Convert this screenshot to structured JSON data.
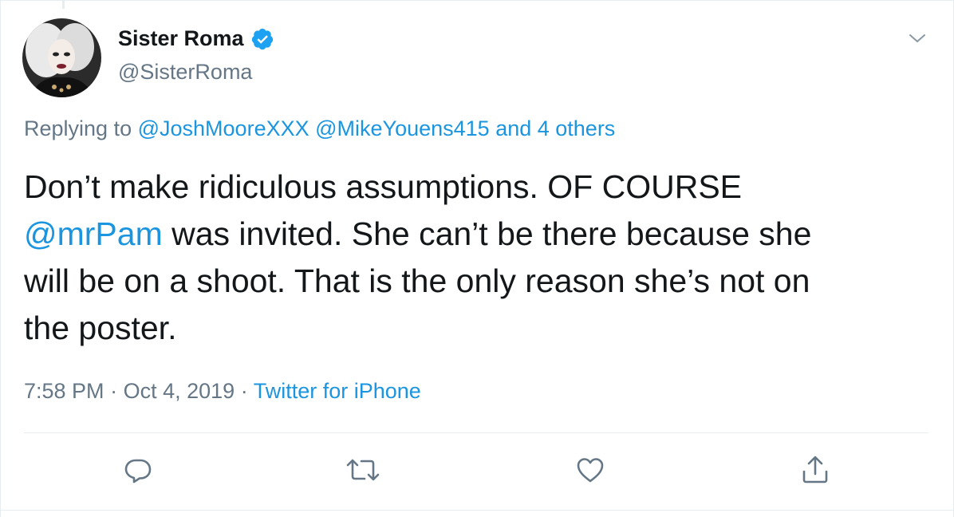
{
  "author": {
    "display_name": "Sister Roma",
    "handle": "@SisterRoma",
    "verified_icon": "verified-badge-icon",
    "avatar_icon": "avatar"
  },
  "menu": {
    "icon": "chevron-down-icon"
  },
  "reply_context": {
    "prefix": "Replying to",
    "mentions": [
      "@JoshMooreXXX",
      "@MikeYouens415"
    ],
    "others": "and 4 others"
  },
  "tweet": {
    "line1": "Don’t make ridiculous assumptions. OF COURSE",
    "mention": "@mrPam",
    "line2_rest": " was invited. She can’t be there because she",
    "line3": "will be on a shoot. That is the only reason she’s not on",
    "line4": "the poster."
  },
  "meta": {
    "time": "7:58 PM",
    "sep1": "·",
    "date": "Oct 4, 2019",
    "sep2": "·",
    "source": "Twitter for iPhone"
  },
  "actions": [
    {
      "name": "reply",
      "icon": "reply-icon"
    },
    {
      "name": "retweet",
      "icon": "retweet-icon"
    },
    {
      "name": "like",
      "icon": "heart-icon"
    },
    {
      "name": "share",
      "icon": "share-icon"
    }
  ],
  "colors": {
    "text": "#14171a",
    "secondary": "#657786",
    "link": "#1b95e0",
    "verified": "#1da1f2",
    "border": "#e6ecf0"
  }
}
